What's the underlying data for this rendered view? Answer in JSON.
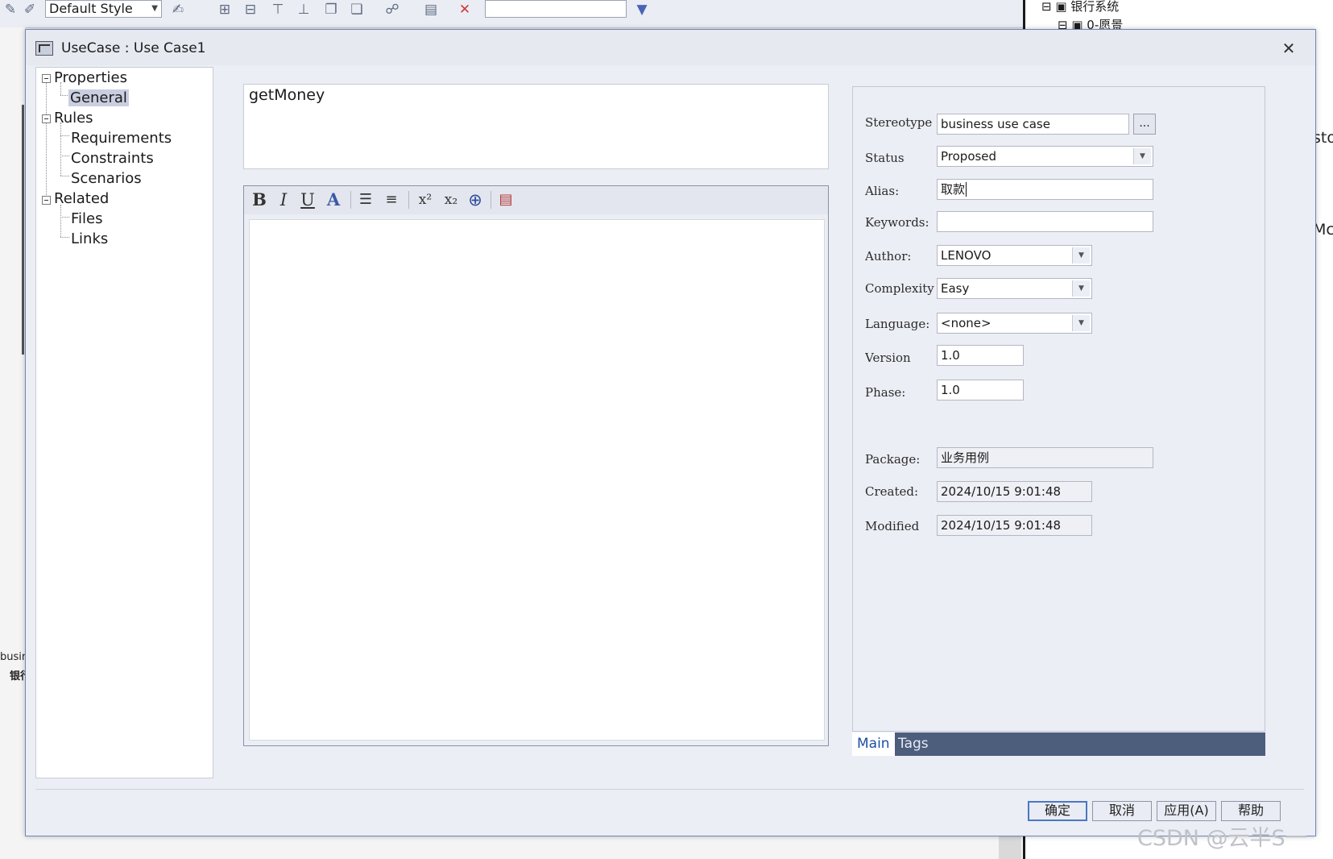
{
  "background": {
    "style_selector": "Default Style",
    "tree_items": [
      "银行系统",
      "0-愿景"
    ],
    "right_stubs": [
      "sto",
      "Mc"
    ],
    "left_stubs": [
      "busin",
      "银行"
    ]
  },
  "dialog": {
    "title": "UseCase : Use Case1",
    "tree": {
      "properties": "Properties",
      "general": "General",
      "rules": "Rules",
      "requirements": "Requirements",
      "constraints": "Constraints",
      "scenarios": "Scenarios",
      "related": "Related",
      "files": "Files",
      "links": "Links"
    },
    "name": "getMoney",
    "notes_toolbar": [
      "bold-icon",
      "italic-icon",
      "underline-icon",
      "font-color-icon",
      "bullet-list-icon",
      "numbered-list-icon",
      "superscript-icon",
      "subscript-icon",
      "hyperlink-icon",
      "document-icon"
    ],
    "fields": {
      "stereotype": {
        "label": "Stereotype",
        "value": "business use case",
        "button": "..."
      },
      "status": {
        "label": "Status",
        "value": "Proposed"
      },
      "alias": {
        "label": "Alias:",
        "value": "取款"
      },
      "keywords": {
        "label": "Keywords:",
        "value": ""
      },
      "author": {
        "label": "Author:",
        "value": "LENOVO"
      },
      "complexity": {
        "label": "Complexity",
        "value": "Easy"
      },
      "language": {
        "label": "Language:",
        "value": "<none>"
      },
      "version": {
        "label": "Version",
        "value": "1.0"
      },
      "phase": {
        "label": "Phase:",
        "value": "1.0"
      },
      "package": {
        "label": "Package:",
        "value": "业务用例"
      },
      "created": {
        "label": "Created:",
        "value": "2024/10/15 9:01:48"
      },
      "modified": {
        "label": "Modified",
        "value": "2024/10/15 9:01:48"
      }
    },
    "tabs": [
      "Main",
      "Tags"
    ],
    "buttons": {
      "ok": "确定",
      "cancel": "取消",
      "apply": "应用(A)",
      "help": "帮助"
    }
  },
  "watermark": "CSDN @云半S一"
}
